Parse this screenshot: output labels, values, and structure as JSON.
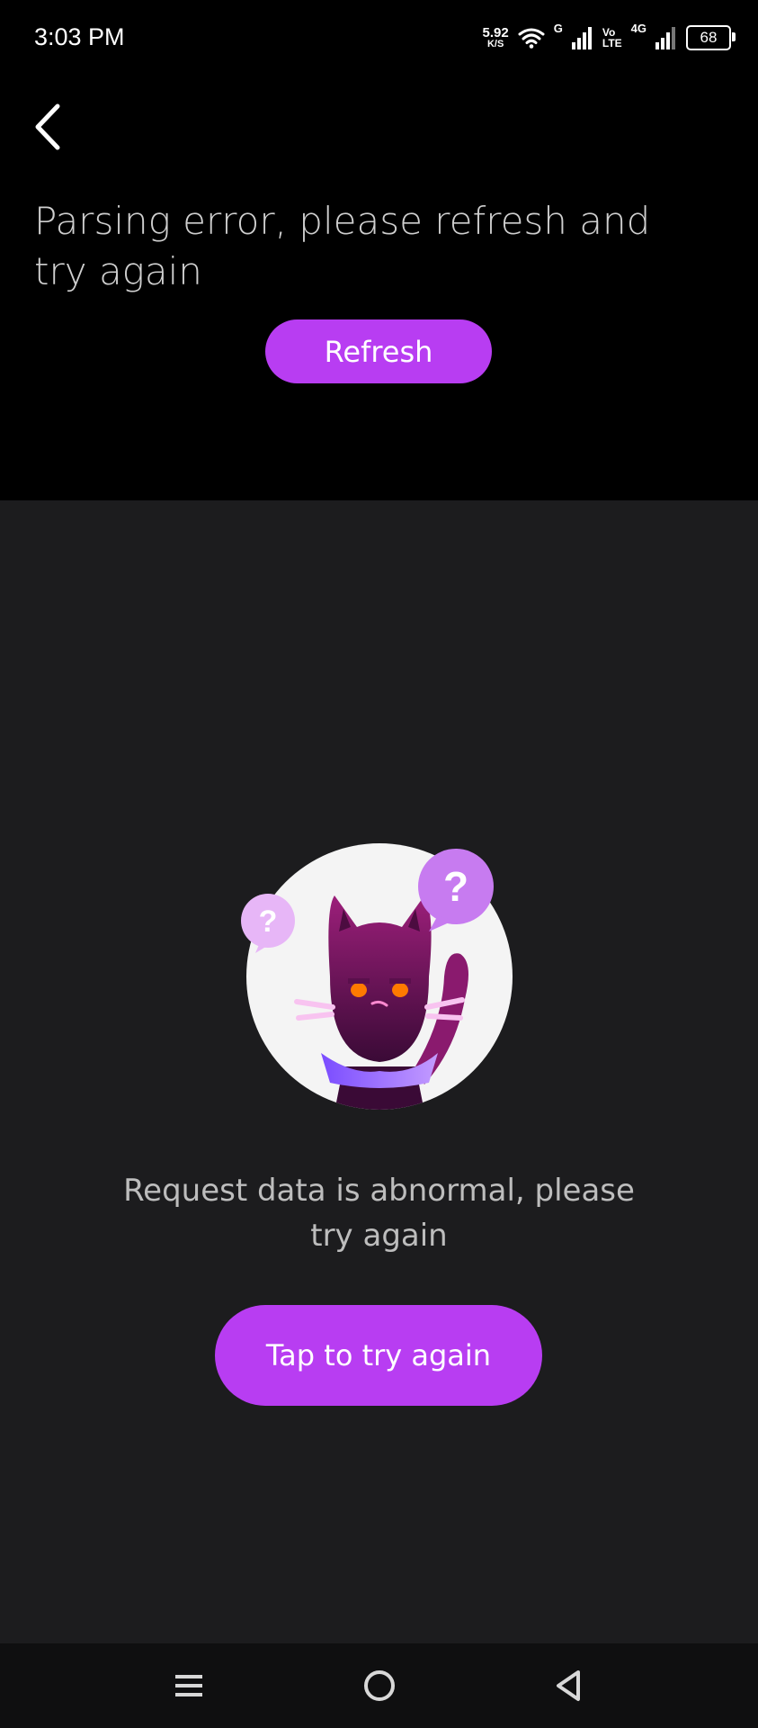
{
  "status_bar": {
    "time": "3:03 PM",
    "net_speed_value": "5.92",
    "net_speed_unit": "K/S",
    "signal1_label": "G",
    "volte_top": "Vo",
    "volte_bottom": "LTE",
    "signal2_label": "4G",
    "battery": "68"
  },
  "header": {
    "back_icon": "chevron-left-icon"
  },
  "error_top": {
    "message": "Parsing error, please refresh and try again",
    "refresh_label": "Refresh"
  },
  "error_main": {
    "illustration": "confused-cat-illustration",
    "message": "Request data is abnormal, please try again",
    "retry_label": "Tap to try again"
  },
  "nav": {
    "menu_icon": "menu-icon",
    "home_icon": "home-icon",
    "back_icon": "back-triangle-icon"
  },
  "colors": {
    "accent": "#b83df2",
    "top_background": "#000000",
    "main_background": "#1c1c1e"
  }
}
